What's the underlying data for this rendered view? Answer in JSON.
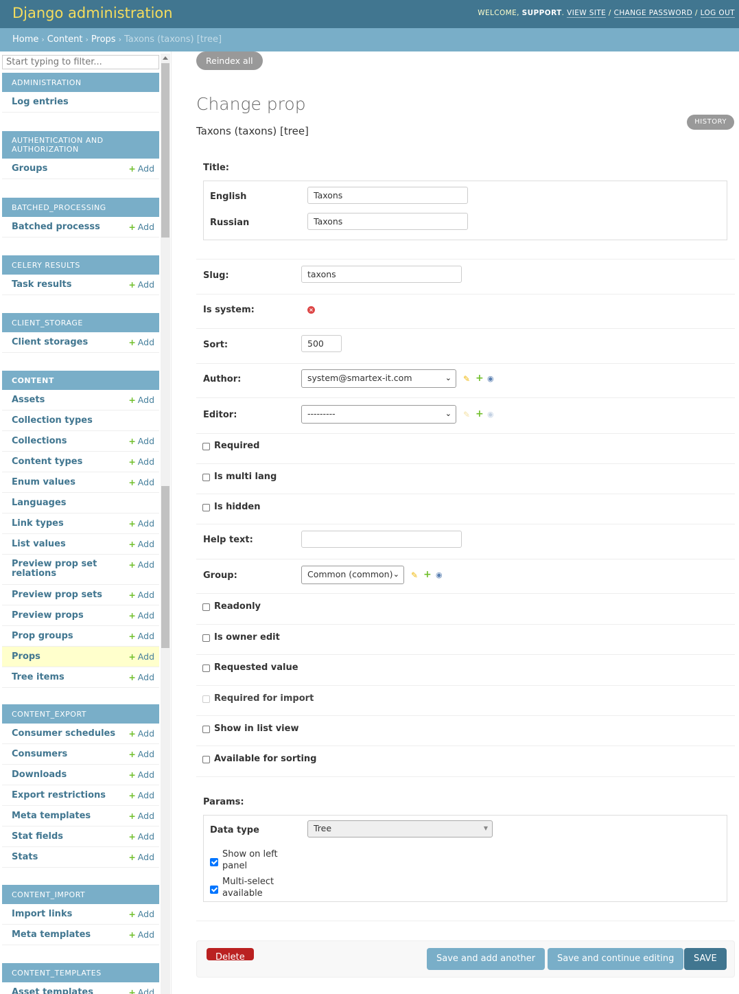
{
  "header": {
    "brand": "Django administration",
    "welcome": "WELCOME,",
    "username": "SUPPORT",
    "view_site": "VIEW SITE",
    "change_password": "CHANGE PASSWORD",
    "log_out": "LOG OUT"
  },
  "breadcrumbs": {
    "home": "Home",
    "content": "Content",
    "props": "Props",
    "current": "Taxons (taxons) [tree]"
  },
  "sidebar": {
    "filter_placeholder": "Start typing to filter...",
    "add_label": "Add",
    "modules": [
      {
        "caption": "Administration",
        "items": [
          {
            "label": "Log entries",
            "add": false
          }
        ]
      },
      {
        "caption": "Authentication and Authorization",
        "items": [
          {
            "label": "Groups",
            "add": true
          }
        ]
      },
      {
        "caption": "Batched_processing",
        "items": [
          {
            "label": "Batched processs",
            "add": true
          }
        ]
      },
      {
        "caption": "Celery Results",
        "items": [
          {
            "label": "Task results",
            "add": true
          }
        ]
      },
      {
        "caption": "Client_storage",
        "items": [
          {
            "label": "Client storages",
            "add": true
          }
        ]
      },
      {
        "caption": "Content",
        "items": [
          {
            "label": "Assets",
            "add": true
          },
          {
            "label": "Collection types",
            "add": false
          },
          {
            "label": "Collections",
            "add": true
          },
          {
            "label": "Content types",
            "add": true
          },
          {
            "label": "Enum values",
            "add": true
          },
          {
            "label": "Languages",
            "add": false
          },
          {
            "label": "Link types",
            "add": true
          },
          {
            "label": "List values",
            "add": true
          },
          {
            "label": "Preview prop set relations",
            "add": true
          },
          {
            "label": "Preview prop sets",
            "add": true
          },
          {
            "label": "Preview props",
            "add": true
          },
          {
            "label": "Prop groups",
            "add": true
          },
          {
            "label": "Props",
            "add": true
          },
          {
            "label": "Tree items",
            "add": true
          }
        ]
      },
      {
        "caption": "Content_export",
        "items": [
          {
            "label": "Consumer schedules",
            "add": true
          },
          {
            "label": "Consumers",
            "add": true
          },
          {
            "label": "Downloads",
            "add": true
          },
          {
            "label": "Export restrictions",
            "add": true
          },
          {
            "label": "Meta templates",
            "add": true
          },
          {
            "label": "Stat fields",
            "add": true
          },
          {
            "label": "Stats",
            "add": true
          }
        ]
      },
      {
        "caption": "Content_import",
        "items": [
          {
            "label": "Import links",
            "add": true
          },
          {
            "label": "Meta templates",
            "add": true
          }
        ]
      },
      {
        "caption": "Content_templates",
        "items": [
          {
            "label": "Asset templates",
            "add": true
          }
        ]
      }
    ]
  },
  "main": {
    "reindex_label": "Reindex all",
    "title": "Change prop",
    "subtitle": "Taxons (taxons) [tree]",
    "history_label": "History",
    "title_field": {
      "label": "Title:",
      "english_label": "English",
      "english_value": "Taxons",
      "russian_label": "Russian",
      "russian_value": "Taxons"
    },
    "slug": {
      "label": "Slug:",
      "value": "taxons"
    },
    "is_system": {
      "label": "Is system:"
    },
    "sort": {
      "label": "Sort:",
      "value": "500"
    },
    "author": {
      "label": "Author:",
      "value": "system@smartex-it.com"
    },
    "editor": {
      "label": "Editor:",
      "value": "---------"
    },
    "checkboxes": {
      "required": "Required",
      "is_multi_lang": "Is multi lang",
      "is_hidden": "Is hidden",
      "readonly": "Readonly",
      "is_owner_edit": "Is owner edit",
      "requested_value": "Requested value",
      "required_for_import": "Required for import",
      "show_in_list_view": "Show in list view",
      "available_for_sorting": "Available for sorting"
    },
    "help_text": {
      "label": "Help text:",
      "value": ""
    },
    "group": {
      "label": "Group:",
      "value": "Common (common)"
    },
    "params": {
      "label": "Params:",
      "data_type_label": "Data type",
      "data_type_value": "Tree",
      "show_on_left_panel": "Show on left panel",
      "multi_select": "Multi-select available"
    },
    "actions": {
      "delete": "Delete",
      "save_add_another": "Save and add another",
      "save_continue": "Save and continue editing",
      "save": "SAVE"
    }
  }
}
